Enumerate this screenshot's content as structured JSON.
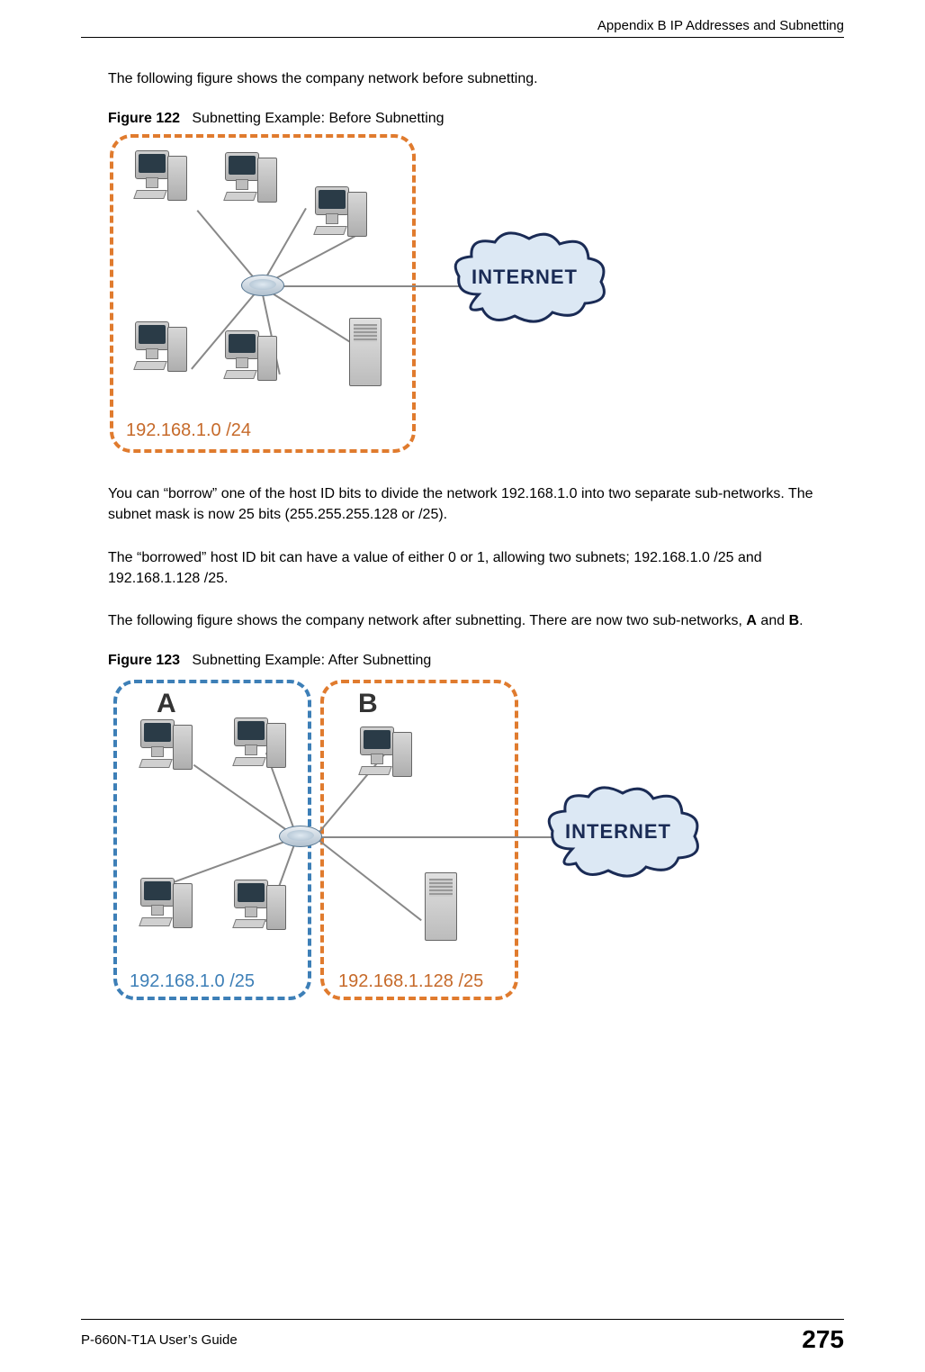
{
  "header": {
    "appendix_title": "Appendix B IP Addresses and Subnetting"
  },
  "body": {
    "p1": "The following figure shows the company network before subnetting.",
    "fig122_num": "Figure 122",
    "fig122_title": "Subnetting Example: Before Subnetting",
    "fig122_network_label": "192.168.1.0 /24",
    "internet_label": "INTERNET",
    "p2": "You can “borrow” one of the host ID bits to divide the network 192.168.1.0 into two separate sub-networks. The subnet mask is now 25 bits (255.255.255.128 or /25).",
    "p3": "The “borrowed” host ID bit can have a value of either 0 or 1, allowing two subnets; 192.168.1.0 /25 and 192.168.1.128 /25.",
    "p4_pre": "The following figure shows the company network after subnetting. There are now two sub-networks, ",
    "p4_a": "A",
    "p4_mid": " and ",
    "p4_b": "B",
    "p4_post": ".",
    "fig123_num": "Figure 123",
    "fig123_title": "Subnetting Example: After Subnetting",
    "fig123_letter_a": "A",
    "fig123_letter_b": "B",
    "fig123_label_a": "192.168.1.0 /25",
    "fig123_label_b": "192.168.1.128 /25"
  },
  "footer": {
    "guide": "P-660N-T1A User’s Guide",
    "page": "275"
  }
}
